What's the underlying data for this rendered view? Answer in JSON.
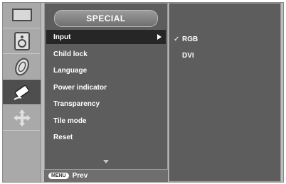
{
  "menu": {
    "title": "SPECIAL",
    "items": [
      {
        "label": "Input"
      },
      {
        "label": "Child lock"
      },
      {
        "label": "Language"
      },
      {
        "label": "Power indicator"
      },
      {
        "label": "Transparency"
      },
      {
        "label": "Tile mode"
      },
      {
        "label": "Reset"
      }
    ],
    "selected_index": 0
  },
  "submenu": {
    "items": [
      {
        "label": "RGB",
        "checked": true
      },
      {
        "label": "DVI",
        "checked": false
      }
    ]
  },
  "footer": {
    "menu_key": "MENU",
    "prev_label": "Prev"
  },
  "sidebar": {
    "icons": [
      "picture-icon",
      "sound-icon",
      "time-icon",
      "special-icon",
      "screen-icon"
    ],
    "active_index": 3
  },
  "colors": {
    "panel_bg": "#5d5d5d",
    "selected_bg": "#262626",
    "sidebar_bg": "#a9a9a9"
  }
}
